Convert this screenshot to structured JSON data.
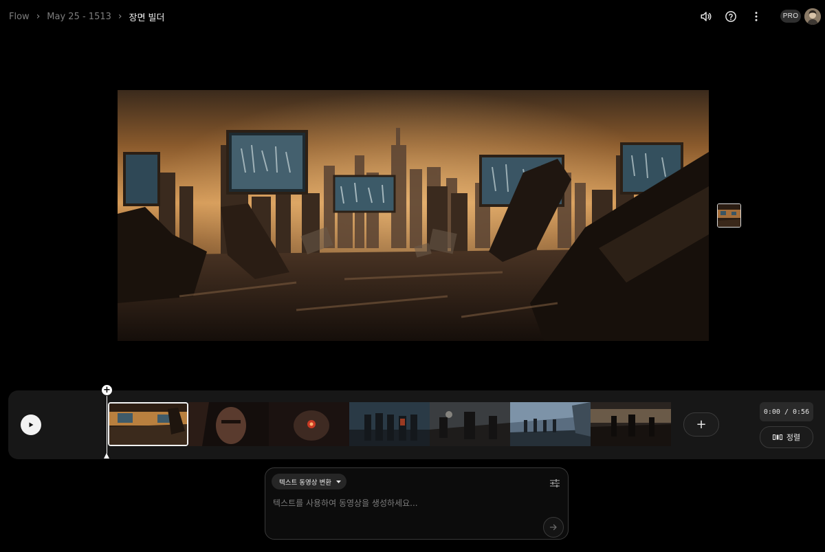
{
  "breadcrumb": {
    "root": "Flow",
    "project": "May 25 - 1513",
    "current": "장면 빌더"
  },
  "header": {
    "icons": [
      "volume-icon",
      "help-icon",
      "more-vert-icon"
    ],
    "plan_badge": "PRO"
  },
  "timeline": {
    "add_marker": "+",
    "clips": [
      {
        "name": "ruined-city-billboards",
        "selected": true
      },
      {
        "name": "man-closeup"
      },
      {
        "name": "robot-red-eye"
      },
      {
        "name": "armored-team"
      },
      {
        "name": "battle-scene"
      },
      {
        "name": "group-silhouettes"
      },
      {
        "name": "wasteland-figures"
      }
    ],
    "add_clip_label": "+",
    "time_display": "0:00 / 0:56",
    "sort_label": "정렬"
  },
  "prompt": {
    "mode_label": "텍스트 동영상 변환",
    "placeholder": "텍스트를 사용하여 동영상을 생성하세요..."
  },
  "colors": {
    "background": "#000000",
    "panel": "#171717",
    "accent": "#f2f2f2"
  }
}
